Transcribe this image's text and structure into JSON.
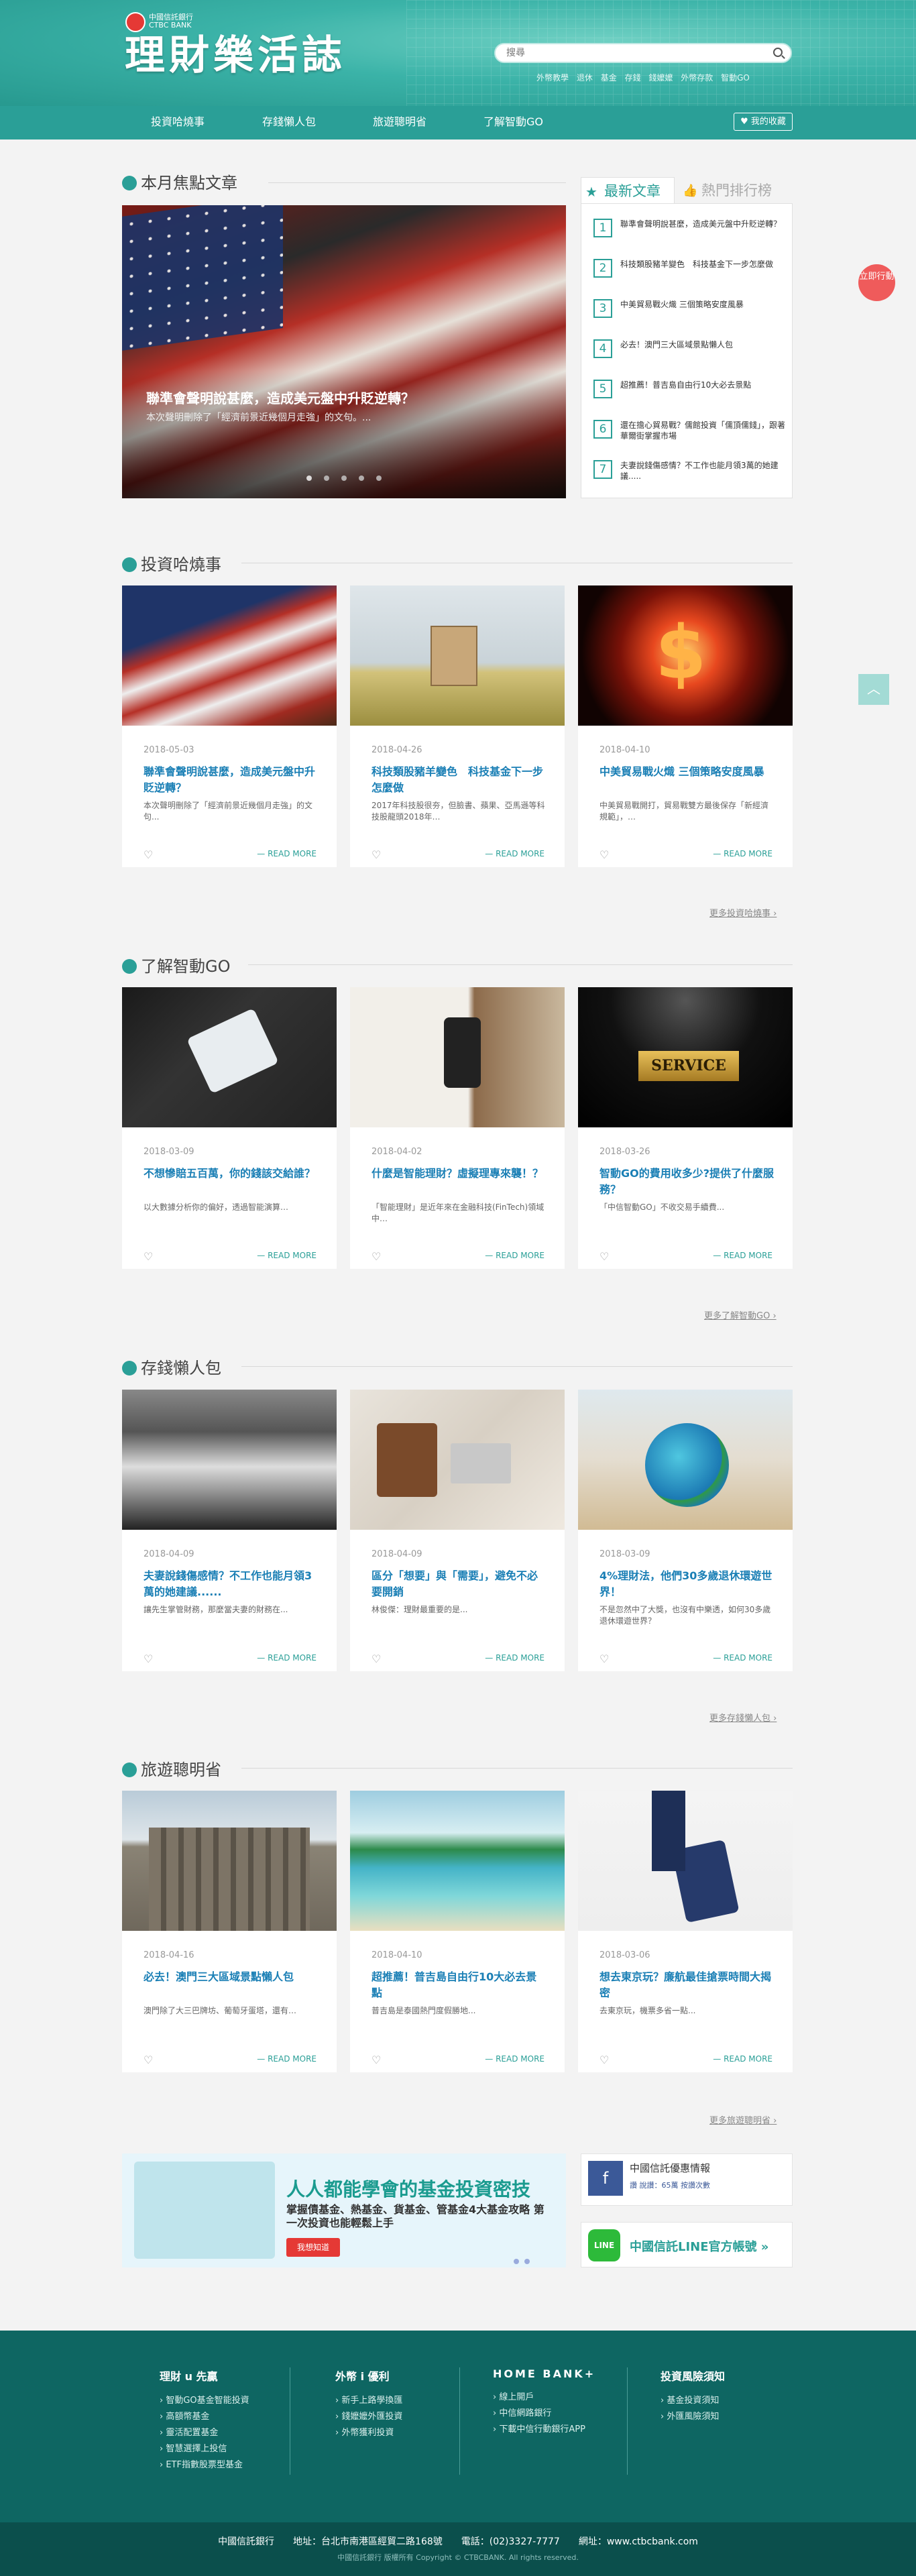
{
  "header": {
    "logo_sub": "中國信託銀行 CTBC BANK",
    "logo_title": "理財樂活誌",
    "search_placeholder": "搜尋",
    "hotwords": [
      "外幣教學",
      "退休",
      "基金",
      "存錢",
      "錢嬤嬤",
      "外幣存款",
      "智動GO"
    ]
  },
  "nav": {
    "items": [
      "投資哈燒事",
      "存錢懶人包",
      "旅遊聰明省",
      "了解智動GO"
    ],
    "fav": "我的收藏"
  },
  "side": {
    "red_label": "立即行動"
  },
  "focus": {
    "title": "本月焦點文章",
    "hero_title": "聯準會聲明說甚麼，造成美元盤中升貶逆轉？",
    "hero_desc": "本次聲明刪除了「經濟前景近幾個月走強」的文句。..."
  },
  "tabs": {
    "latest": "最新文章",
    "hot": "熱門排行榜"
  },
  "latest_list": [
    {
      "n": "1",
      "t": "聯準會聲明說甚麼，造成美元盤中升貶逆轉？"
    },
    {
      "n": "2",
      "t": "科技類股豬羊變色　科技基金下一步怎麼做"
    },
    {
      "n": "3",
      "t": "中美貿易戰火熾 三個策略安度風暴"
    },
    {
      "n": "4",
      "t": "必去！澳門三大區域景點懶人包"
    },
    {
      "n": "5",
      "t": "超推薦！普吉島自由行10大必去景點"
    },
    {
      "n": "6",
      "t": "還在擔心貿易戰？儒館投資「儒頂儒錢」，跟著華爾街掌握市場"
    },
    {
      "n": "7",
      "t": "夫妻說錢傷感情？不工作也能月領3萬的她建議....."
    }
  ],
  "sections": [
    {
      "title": "投資哈燒事",
      "more": "更多投資哈燒事 ›",
      "cards": [
        {
          "date": "2018-05-03",
          "title": "聯準會聲明說甚麼，造成美元盤中升貶逆轉？",
          "desc": "本次聲明刪除了「經濟前景近幾個月走強」的文句..."
        },
        {
          "date": "2018-04-26",
          "title": "科技類股豬羊變色　科技基金下一步怎麼做",
          "desc": "2017年科技股很夯，但臉書、蘋果、亞馬遜等科技股龍頭2018年…"
        },
        {
          "date": "2018-04-10",
          "title": "中美貿易戰火熾 三個策略安度風暴",
          "desc": "中美貿易戰開打，貿易戰雙方最後保存「新經濟規範」，…"
        }
      ]
    },
    {
      "title": "了解智動GO",
      "more": "更多了解智動GO ›",
      "cards": [
        {
          "date": "2018-03-09",
          "title": "不想慘賠五百萬，你的錢該交給誰？",
          "desc": "以大數據分析你的偏好，透過智能演算…"
        },
        {
          "date": "2018-04-02",
          "title": "什麼是智能理財？虛擬理專來襲！？",
          "desc": "「智能理財」是近年來在金融科技(FinTech)領域中…"
        },
        {
          "date": "2018-03-26",
          "title": "智動GO的費用收多少?提供了什麼服務？",
          "desc": "「中信智動GO」不收交易手續費..."
        }
      ]
    },
    {
      "title": "存錢懶人包",
      "more": "更多存錢懶人包 ›",
      "cards": [
        {
          "date": "2018-04-09",
          "title": "夫妻說錢傷感情？不工作也能月領3萬的她建議......",
          "desc": "讓先生掌管財務，那麼當夫妻的財務在..."
        },
        {
          "date": "2018-04-09",
          "title": "區分「想要」與「需要」，避免不必要開銷",
          "desc": "林俊傑：理財最重要的是..."
        },
        {
          "date": "2018-03-09",
          "title": "4%理財法，他們30多歲退休環遊世界！",
          "desc": "不是忽然中了大獎，也沒有中樂透，如何30多歲退休環遊世界？"
        }
      ]
    },
    {
      "title": "旅遊聰明省",
      "more": "更多旅遊聰明省 ›",
      "cards": [
        {
          "date": "2018-04-16",
          "title": "必去！澳門三大區域景點懶人包",
          "desc": "澳門除了大三巴牌坊、葡萄牙蛋塔，還有…"
        },
        {
          "date": "2018-04-10",
          "title": "超推薦！普吉島自由行10大必去景點",
          "desc": "普吉島是泰國熱門度假勝地..."
        },
        {
          "date": "2018-03-06",
          "title": "想去東京玩？廉航最佳搶票時間大揭密",
          "desc": "去東京玩，機票多省一點..."
        }
      ]
    }
  ],
  "card_more": "READ MORE",
  "banner": {
    "t1": "人人都能學會的基金投資密技",
    "t2": "掌握債基金、熱基金、貨基金、管基金4大基金攻略 第一次投資也能輕鬆上手",
    "btn": "我想知道"
  },
  "fb": {
    "name": "中國信託優惠情報",
    "sub": "讚 說讚：65萬 按讚次數"
  },
  "line": {
    "txt": "中國信託LINE官方帳號 »",
    "logo": "LINE"
  },
  "footer": {
    "cols": [
      {
        "h": "理財 u 先贏",
        "items": [
          "智動GO基金智能投資",
          "高額幣基金",
          "靈活配置基金",
          "智慧選擇上投信",
          "ETF指數股票型基金"
        ]
      },
      {
        "h": "外幣 i 優利",
        "items": [
          "新手上路學換匯",
          "錢嬤嬤外匯投資",
          "外幣獲利投資"
        ]
      },
      {
        "h": "HOME BANK+",
        "items": [
          "線上開戶",
          "中信網路銀行",
          "下載中信行動銀行APP"
        ]
      },
      {
        "h": "投資風險須知",
        "items": [
          "基金投資須知",
          "外匯風險須知"
        ]
      }
    ],
    "copy1": "中國信託銀行　　地址：台北市南港區經貿二路168號　　電話：(02)3327-7777　　網址：www.ctbcbank.com",
    "copy2": "中國信託銀行 版權所有 Copyright © CTBCBANK. All rights reserved."
  },
  "colors": {
    "teal": "#2a9f97",
    "red": "#e53935",
    "link": "#1a7fb5"
  }
}
